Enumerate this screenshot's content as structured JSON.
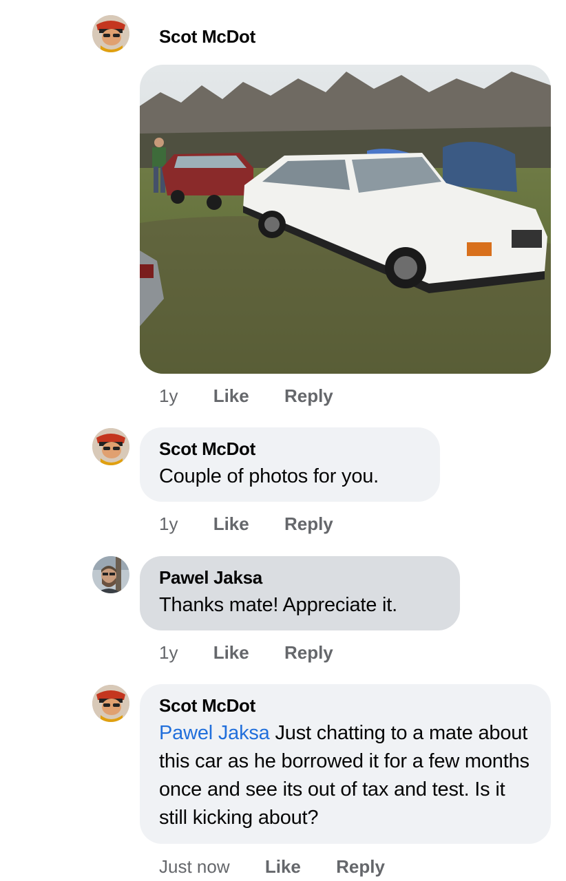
{
  "comments": [
    {
      "author": "Scot McDot",
      "avatar_icon": "user-avatar-icon",
      "attachment": "photo of a white estate car and a red saloon car parked on grass",
      "time": "1y",
      "like": "Like",
      "reply": "Reply"
    },
    {
      "author": "Scot McDot",
      "avatar_icon": "user-avatar-icon",
      "text": "Couple of photos for you.",
      "time": "1y",
      "like": "Like",
      "reply": "Reply"
    },
    {
      "author": "Pawel Jaksa",
      "avatar_icon": "user-avatar-icon",
      "text": "Thanks mate! Appreciate it.",
      "time": "1y",
      "like": "Like",
      "reply": "Reply"
    },
    {
      "author": "Scot McDot",
      "avatar_icon": "user-avatar-icon",
      "mention": "Pawel Jaksa",
      "text": " Just chatting to a mate about this car as he borrowed it for a few months once and see its out of tax and test. Is it still kicking about?",
      "time": "Just now",
      "like": "Like",
      "reply": "Reply"
    }
  ],
  "colors": {
    "bubble_light": "#f0f2f5",
    "bubble_selected": "#dadde1",
    "mention": "#216fdb",
    "meta_text": "#65676b"
  }
}
